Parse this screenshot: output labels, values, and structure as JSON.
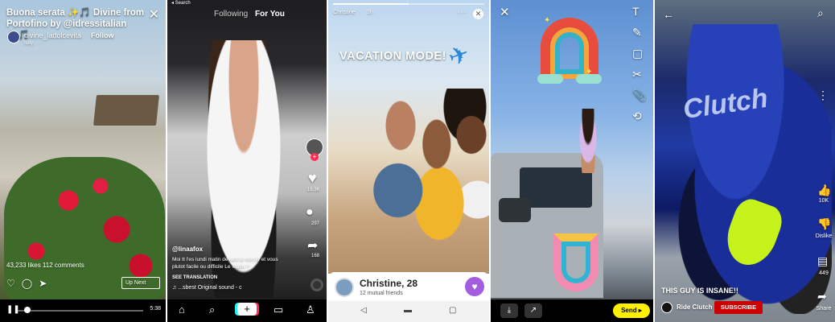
{
  "instagram": {
    "title": "Buona serata ✨🎵 Divine from Portofino by @idressitalian ✨🎵",
    "username": "divine_ladolcevita",
    "follow": "Follow",
    "location": "Italy",
    "stats": "43,233 likes   112 comments",
    "up_next": "Up Next",
    "time": "5:38",
    "progress": 0.05,
    "icons": [
      "heart-icon",
      "comment-icon",
      "send-icon"
    ]
  },
  "tiktok": {
    "back_label": "◂ Search",
    "tab_following": "Following",
    "tab_for_you": "For You",
    "likes": "16.3K",
    "comments": "297",
    "shares": "168",
    "handle": "@linaafox",
    "caption": "Moi tt l'es lundi matin devant le mirroir et vous plutot facile ou difficile Le Matin ?",
    "see_translation": "SEE TRANSLATION",
    "music": "♫ ...sbest   Original sound - c"
  },
  "dating": {
    "story_name": "Christine",
    "story_time": "3h",
    "sticker_text": "VACATION MODE!",
    "card_name": "Christine, 28",
    "mutual": "12 mutual friends",
    "accent": "#a35ee0",
    "progress": 0.5
  },
  "snapchat": {
    "tools": [
      "T",
      "✎",
      "▢",
      "✂",
      "📎",
      "⟲"
    ],
    "send_label": "Send ▸",
    "accent": "#fff000"
  },
  "youtube": {
    "caption": "THIS GUY IS INSANE!!",
    "channel": "Ride Clutch",
    "subscribe": "SUBSCRIBE",
    "likes": "10K",
    "dislike": "Dislike",
    "comments": "449",
    "share": "Share",
    "brand_text": "Clutch",
    "accent": "#cc0000"
  }
}
